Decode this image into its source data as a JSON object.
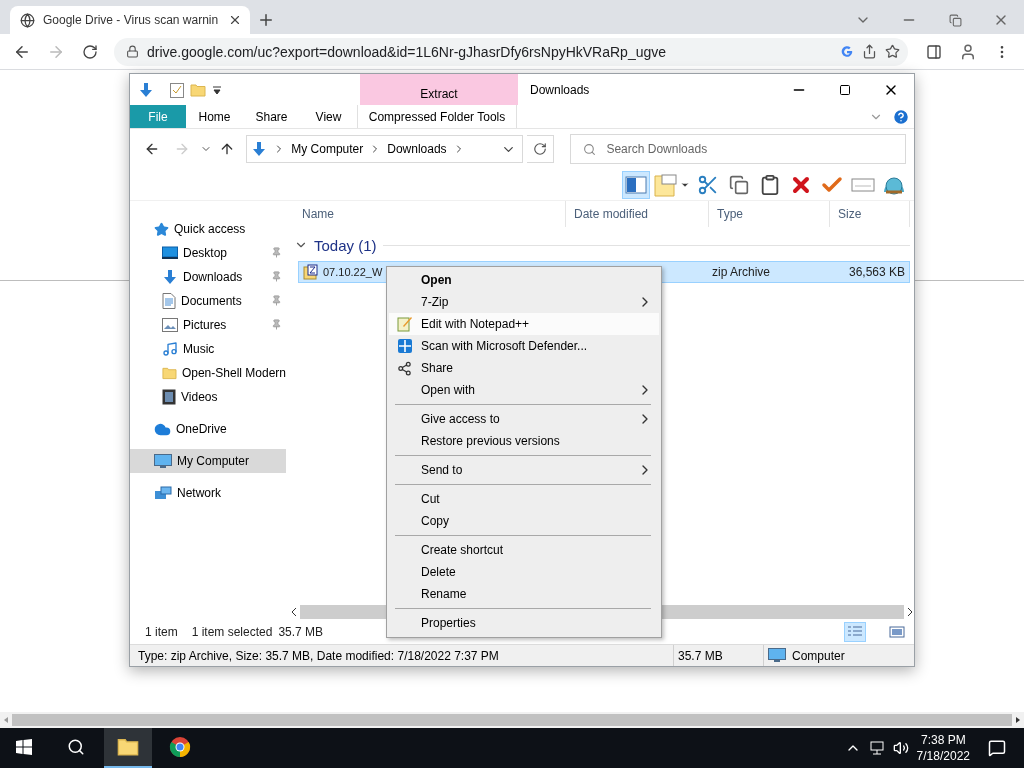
{
  "browser": {
    "tab_title": "Google Drive - Virus scan warnin",
    "url": "drive.google.com/uc?export=download&id=1L6Nr-gJhasrDfy6rsNpyHkVRaRp_ugve"
  },
  "explorer": {
    "title": "Downloads",
    "context_tab_group": "Extract",
    "ribbon_tabs": [
      {
        "label": "File",
        "kind": "file"
      },
      {
        "label": "Home",
        "kind": "tab"
      },
      {
        "label": "Share",
        "kind": "tab"
      },
      {
        "label": "View",
        "kind": "tab"
      },
      {
        "label": "Compressed Folder Tools",
        "kind": "context"
      }
    ],
    "breadcrumbs": [
      "My Computer",
      "Downloads"
    ],
    "search": {
      "placeholder": "Search Downloads"
    },
    "preview_pane": {
      "selected": true
    },
    "nav": [
      {
        "label": "Quick access",
        "kind": "star",
        "selected": false,
        "children": [
          {
            "label": "Desktop",
            "kind": "desktop",
            "pinned": true,
            "selected": false
          },
          {
            "label": "Downloads",
            "kind": "download",
            "pinned": true,
            "selected": false
          },
          {
            "label": "Documents",
            "kind": "document",
            "pinned": true,
            "selected": false
          },
          {
            "label": "Pictures",
            "kind": "picture",
            "pinned": true,
            "selected": false
          },
          {
            "label": "Music",
            "kind": "music",
            "pinned": false,
            "selected": false
          },
          {
            "label": "Open-Shell Modern",
            "kind": "folder",
            "pinned": false,
            "selected": false
          },
          {
            "label": "Videos",
            "kind": "video",
            "pinned": false,
            "selected": false
          }
        ]
      },
      {
        "label": "OneDrive",
        "kind": "cloud",
        "selected": false
      },
      {
        "label": "My Computer",
        "kind": "computer",
        "selected": true
      },
      {
        "label": "Network",
        "kind": "network",
        "selected": false
      }
    ],
    "columns": [
      "Name",
      "Date modified",
      "Type",
      "Size"
    ],
    "group": "Today (1)",
    "rows": [
      {
        "name": "07.10.22_W",
        "type": "zip Archive",
        "size": "36,563 KB",
        "selected": true
      }
    ],
    "status": {
      "count": "1 item",
      "selection": "1 item selected",
      "selection_size": "35.7 MB"
    },
    "details_bar": {
      "info": "Type: zip Archive, Size: 35.7 MB, Date modified: 7/18/2022 7:37 PM",
      "size": "35.7 MB",
      "location": "Computer"
    }
  },
  "context_menu": [
    {
      "kind": "item",
      "label": "Open",
      "default": true,
      "submenu": false,
      "hovered": false
    },
    {
      "kind": "item",
      "label": "7-Zip",
      "default": false,
      "submenu": true,
      "hovered": false
    },
    {
      "kind": "notepad",
      "label": "Edit with Notepad++",
      "default": false,
      "submenu": false,
      "hovered": true
    },
    {
      "kind": "defender",
      "label": "Scan with Microsoft Defender...",
      "default": false,
      "submenu": false,
      "hovered": false
    },
    {
      "kind": "share",
      "label": "Share",
      "default": false,
      "submenu": false,
      "hovered": false
    },
    {
      "kind": "item",
      "label": "Open with",
      "default": false,
      "submenu": true,
      "hovered": false
    },
    {
      "kind": "separator"
    },
    {
      "kind": "item",
      "label": "Give access to",
      "default": false,
      "submenu": true,
      "hovered": false
    },
    {
      "kind": "item",
      "label": "Restore previous versions",
      "default": false,
      "submenu": false,
      "hovered": false
    },
    {
      "kind": "separator"
    },
    {
      "kind": "item",
      "label": "Send to",
      "default": false,
      "submenu": true,
      "hovered": false
    },
    {
      "kind": "separator"
    },
    {
      "kind": "item",
      "label": "Cut",
      "default": false,
      "submenu": false,
      "hovered": false
    },
    {
      "kind": "item",
      "label": "Copy",
      "default": false,
      "submenu": false,
      "hovered": false
    },
    {
      "kind": "separator"
    },
    {
      "kind": "item",
      "label": "Create shortcut",
      "default": false,
      "submenu": false,
      "hovered": false
    },
    {
      "kind": "item",
      "label": "Delete",
      "default": false,
      "submenu": false,
      "hovered": false
    },
    {
      "kind": "item",
      "label": "Rename",
      "default": false,
      "submenu": false,
      "hovered": false
    },
    {
      "kind": "separator"
    },
    {
      "kind": "item",
      "label": "Properties",
      "default": false,
      "submenu": false,
      "hovered": false
    }
  ],
  "taskbar": {
    "apps": [
      {
        "kind": "explorer",
        "active": true
      },
      {
        "kind": "chrome",
        "active": false
      }
    ],
    "time": "7:38 PM",
    "date": "7/18/2022"
  }
}
